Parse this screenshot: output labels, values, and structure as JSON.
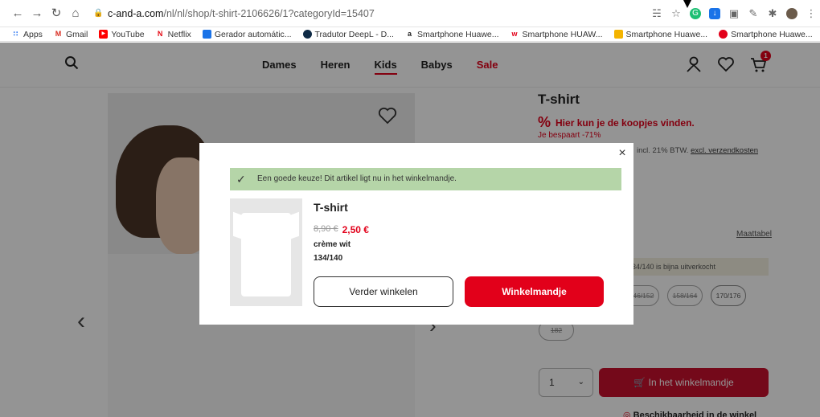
{
  "browser": {
    "url_host": "c-and-a.com",
    "url_path": "/nl/nl/shop/t-shirt-2106626/1?categoryId=15407",
    "bookmarks": [
      {
        "label": "Apps",
        "icon": "apps-grid-icon",
        "color": "#4285f4"
      },
      {
        "label": "Gmail",
        "icon": "gmail-icon",
        "color": "#d93025"
      },
      {
        "label": "YouTube",
        "icon": "youtube-icon",
        "color": "#ff0000"
      },
      {
        "label": "Netflix",
        "icon": "netflix-icon",
        "color": "#e50914"
      },
      {
        "label": "Gerador automátic...",
        "icon": "doc-icon",
        "color": "#1a73e8"
      },
      {
        "label": "Tradutor DeepL - D...",
        "icon": "deepl-icon",
        "color": "#0f2b46"
      },
      {
        "label": "Smartphone Huawe...",
        "icon": "amazon-icon",
        "color": "#222222"
      },
      {
        "label": "Smartphone HUAW...",
        "icon": "worten-icon",
        "color": "#e2001a"
      },
      {
        "label": "Smartphone Huawe...",
        "icon": "folder-icon",
        "color": "#f4b400"
      },
      {
        "label": "Smartphone Huawe...",
        "icon": "huawei-icon",
        "color": "#e2001a"
      }
    ]
  },
  "site": {
    "nav": [
      {
        "label": "Dames"
      },
      {
        "label": "Heren"
      },
      {
        "label": "Kids"
      },
      {
        "label": "Babys"
      },
      {
        "label": "Sale"
      }
    ],
    "cart_count": "1",
    "accent": "#e2001a"
  },
  "product": {
    "title": "T-shirt",
    "promo": "Hier kun je de koopjes vinden.",
    "promo_symbol": "%",
    "saving": "Je bespaart -71%",
    "vat_text": "incl. 21% BTW.",
    "shipping_link": "excl. verzendkosten",
    "size_chart": "Maattabel",
    "stock_note": "34/140 is bijna uitverkocht",
    "sizes": [
      "146/152",
      "158/164",
      "170/176"
    ],
    "size_last": "182",
    "quantity": "1",
    "add_to_cart": "In het winkelmandje",
    "store_link": "Beschikbaarheid in de winkel"
  },
  "modal": {
    "success": "Een goede keuze! Dit artikel ligt nu in het winkelmandje.",
    "title": "T-shirt",
    "old_price": "8,90 €",
    "new_price": "2,50 €",
    "color": "crème wit",
    "size": "134/140",
    "continue_label": "Verder winkelen",
    "cart_label": "Winkelmandje"
  }
}
